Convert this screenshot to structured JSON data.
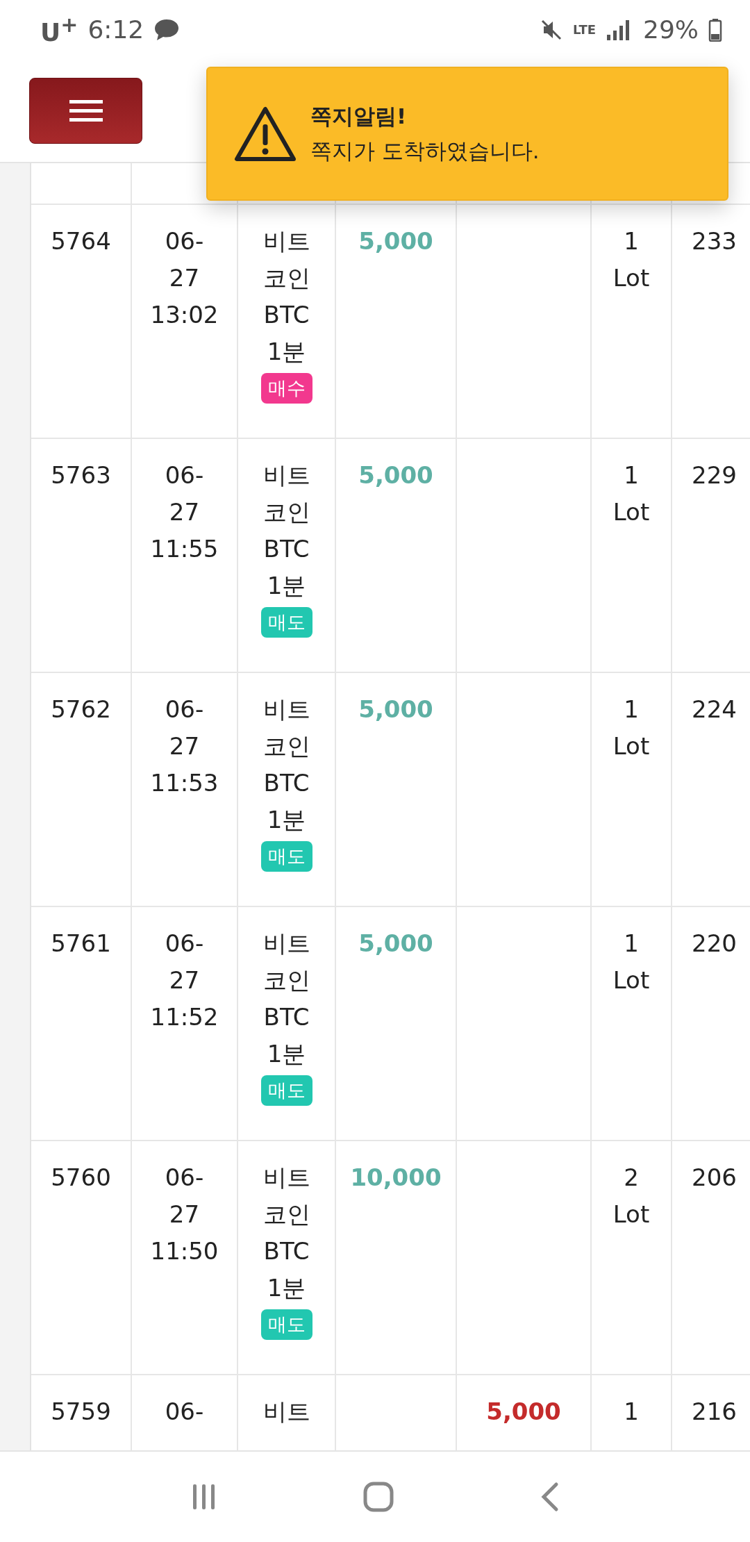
{
  "status_bar": {
    "carrier": "U$^{+}$",
    "time": "6:12",
    "network": "LTE",
    "battery": "29%"
  },
  "toast": {
    "title": "쪽지알림!",
    "message": "쪽지가 도착하였습니다."
  },
  "table": {
    "rows": [
      {
        "id": "5764",
        "date": "06-\n27\n13:02",
        "product": "비트\n코인\nBTC\n1분",
        "badge": {
          "label": "매수",
          "kind": "buy"
        },
        "profit": "5,000",
        "quantity": "1\nLot",
        "column_8": "233"
      },
      {
        "id": "5763",
        "date": "06-\n27\n11:55",
        "product": "비트\n코인\nBTC\n1분",
        "badge": {
          "label": "매도",
          "kind": "sell"
        },
        "profit": "5,000",
        "quantity": "1\nLot",
        "column_8": "229"
      },
      {
        "id": "5762",
        "date": "06-\n27\n11:53",
        "product": "비트\n코인\nBTC\n1분",
        "badge": {
          "label": "매도",
          "kind": "sell"
        },
        "profit": "5,000",
        "quantity": "1\nLot",
        "column_8": "224"
      },
      {
        "id": "5761",
        "date": "06-\n27\n11:52",
        "product": "비트\n코인\nBTC\n1분",
        "badge": {
          "label": "매도",
          "kind": "sell"
        },
        "profit": "5,000",
        "quantity": "1\nLot",
        "column_8": "220"
      },
      {
        "id": "5760",
        "date": "06-\n27\n11:50",
        "product": "비트\n코인\nBTC\n1분",
        "badge": {
          "label": "매도",
          "kind": "sell"
        },
        "profit": "10,000",
        "quantity": "2\nLot",
        "column_8": "206"
      },
      {
        "id": "5759",
        "date": "06-",
        "product": "비트",
        "loss": "5,000",
        "quantity": "1",
        "column_8": "216"
      }
    ]
  }
}
